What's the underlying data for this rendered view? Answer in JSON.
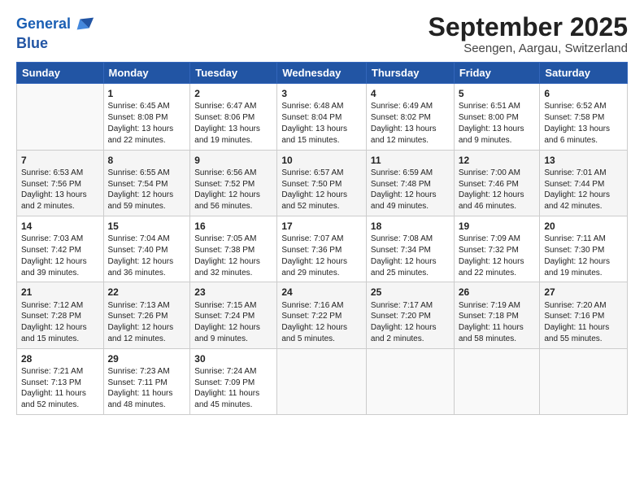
{
  "logo": {
    "line1": "General",
    "line2": "Blue"
  },
  "title": "September 2025",
  "location": "Seengen, Aargau, Switzerland",
  "headers": [
    "Sunday",
    "Monday",
    "Tuesday",
    "Wednesday",
    "Thursday",
    "Friday",
    "Saturday"
  ],
  "rows": [
    [
      {
        "day": "",
        "content": ""
      },
      {
        "day": "1",
        "content": "Sunrise: 6:45 AM\nSunset: 8:08 PM\nDaylight: 13 hours\nand 22 minutes."
      },
      {
        "day": "2",
        "content": "Sunrise: 6:47 AM\nSunset: 8:06 PM\nDaylight: 13 hours\nand 19 minutes."
      },
      {
        "day": "3",
        "content": "Sunrise: 6:48 AM\nSunset: 8:04 PM\nDaylight: 13 hours\nand 15 minutes."
      },
      {
        "day": "4",
        "content": "Sunrise: 6:49 AM\nSunset: 8:02 PM\nDaylight: 13 hours\nand 12 minutes."
      },
      {
        "day": "5",
        "content": "Sunrise: 6:51 AM\nSunset: 8:00 PM\nDaylight: 13 hours\nand 9 minutes."
      },
      {
        "day": "6",
        "content": "Sunrise: 6:52 AM\nSunset: 7:58 PM\nDaylight: 13 hours\nand 6 minutes."
      }
    ],
    [
      {
        "day": "7",
        "content": "Sunrise: 6:53 AM\nSunset: 7:56 PM\nDaylight: 13 hours\nand 2 minutes."
      },
      {
        "day": "8",
        "content": "Sunrise: 6:55 AM\nSunset: 7:54 PM\nDaylight: 12 hours\nand 59 minutes."
      },
      {
        "day": "9",
        "content": "Sunrise: 6:56 AM\nSunset: 7:52 PM\nDaylight: 12 hours\nand 56 minutes."
      },
      {
        "day": "10",
        "content": "Sunrise: 6:57 AM\nSunset: 7:50 PM\nDaylight: 12 hours\nand 52 minutes."
      },
      {
        "day": "11",
        "content": "Sunrise: 6:59 AM\nSunset: 7:48 PM\nDaylight: 12 hours\nand 49 minutes."
      },
      {
        "day": "12",
        "content": "Sunrise: 7:00 AM\nSunset: 7:46 PM\nDaylight: 12 hours\nand 46 minutes."
      },
      {
        "day": "13",
        "content": "Sunrise: 7:01 AM\nSunset: 7:44 PM\nDaylight: 12 hours\nand 42 minutes."
      }
    ],
    [
      {
        "day": "14",
        "content": "Sunrise: 7:03 AM\nSunset: 7:42 PM\nDaylight: 12 hours\nand 39 minutes."
      },
      {
        "day": "15",
        "content": "Sunrise: 7:04 AM\nSunset: 7:40 PM\nDaylight: 12 hours\nand 36 minutes."
      },
      {
        "day": "16",
        "content": "Sunrise: 7:05 AM\nSunset: 7:38 PM\nDaylight: 12 hours\nand 32 minutes."
      },
      {
        "day": "17",
        "content": "Sunrise: 7:07 AM\nSunset: 7:36 PM\nDaylight: 12 hours\nand 29 minutes."
      },
      {
        "day": "18",
        "content": "Sunrise: 7:08 AM\nSunset: 7:34 PM\nDaylight: 12 hours\nand 25 minutes."
      },
      {
        "day": "19",
        "content": "Sunrise: 7:09 AM\nSunset: 7:32 PM\nDaylight: 12 hours\nand 22 minutes."
      },
      {
        "day": "20",
        "content": "Sunrise: 7:11 AM\nSunset: 7:30 PM\nDaylight: 12 hours\nand 19 minutes."
      }
    ],
    [
      {
        "day": "21",
        "content": "Sunrise: 7:12 AM\nSunset: 7:28 PM\nDaylight: 12 hours\nand 15 minutes."
      },
      {
        "day": "22",
        "content": "Sunrise: 7:13 AM\nSunset: 7:26 PM\nDaylight: 12 hours\nand 12 minutes."
      },
      {
        "day": "23",
        "content": "Sunrise: 7:15 AM\nSunset: 7:24 PM\nDaylight: 12 hours\nand 9 minutes."
      },
      {
        "day": "24",
        "content": "Sunrise: 7:16 AM\nSunset: 7:22 PM\nDaylight: 12 hours\nand 5 minutes."
      },
      {
        "day": "25",
        "content": "Sunrise: 7:17 AM\nSunset: 7:20 PM\nDaylight: 12 hours\nand 2 minutes."
      },
      {
        "day": "26",
        "content": "Sunrise: 7:19 AM\nSunset: 7:18 PM\nDaylight: 11 hours\nand 58 minutes."
      },
      {
        "day": "27",
        "content": "Sunrise: 7:20 AM\nSunset: 7:16 PM\nDaylight: 11 hours\nand 55 minutes."
      }
    ],
    [
      {
        "day": "28",
        "content": "Sunrise: 7:21 AM\nSunset: 7:13 PM\nDaylight: 11 hours\nand 52 minutes."
      },
      {
        "day": "29",
        "content": "Sunrise: 7:23 AM\nSunset: 7:11 PM\nDaylight: 11 hours\nand 48 minutes."
      },
      {
        "day": "30",
        "content": "Sunrise: 7:24 AM\nSunset: 7:09 PM\nDaylight: 11 hours\nand 45 minutes."
      },
      {
        "day": "",
        "content": ""
      },
      {
        "day": "",
        "content": ""
      },
      {
        "day": "",
        "content": ""
      },
      {
        "day": "",
        "content": ""
      }
    ]
  ]
}
